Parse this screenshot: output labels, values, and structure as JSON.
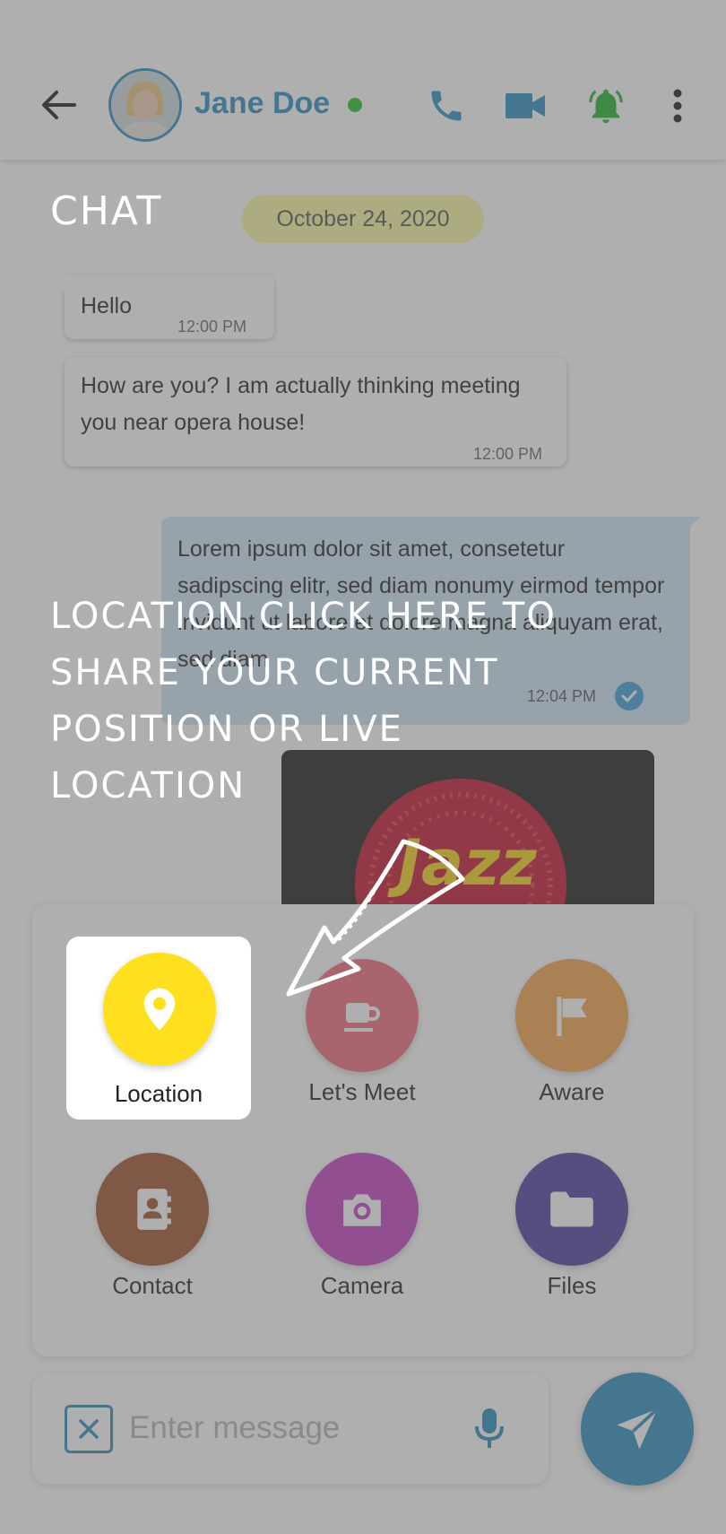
{
  "header": {
    "contact_name": "Jane Doe",
    "status": "online",
    "colors": {
      "brand": "#2a8cc0",
      "online": "#22c02a",
      "bell": "#1fb52b"
    }
  },
  "chat": {
    "date": "October 24, 2020",
    "messages_in": [
      {
        "text": "Hello",
        "time": "12:00 PM"
      },
      {
        "text": "How are you? I am actually thinking meeting you near opera house!",
        "time": "12:00 PM"
      }
    ],
    "message_out": {
      "text": "Lorem ipsum dolor sit amet, consetetur sadipscing elitr, sed diam nonumy eirmod tempor invidunt ut labore et dolore magna aliquyam erat, sed diam",
      "time": "12:04 PM"
    },
    "image_label": "Jazz"
  },
  "attachments": [
    {
      "label": "Location",
      "icon": "map-pin-icon",
      "color": "#ffe01e"
    },
    {
      "label": "Let's Meet",
      "icon": "coffee-cup-icon",
      "color": "#f06a7c"
    },
    {
      "label": "Aware",
      "icon": "flag-icon",
      "color": "#f2a24a"
    },
    {
      "label": "Contact",
      "icon": "address-book-icon",
      "color": "#a0522d"
    },
    {
      "label": "Camera",
      "icon": "camera-icon",
      "color": "#c33ec3"
    },
    {
      "label": "Files",
      "icon": "folder-icon",
      "color": "#4b3fa0"
    }
  ],
  "input": {
    "placeholder": "Enter message"
  },
  "coach": {
    "title": "CHAT",
    "text": "Location click here to share your current position or live location"
  }
}
